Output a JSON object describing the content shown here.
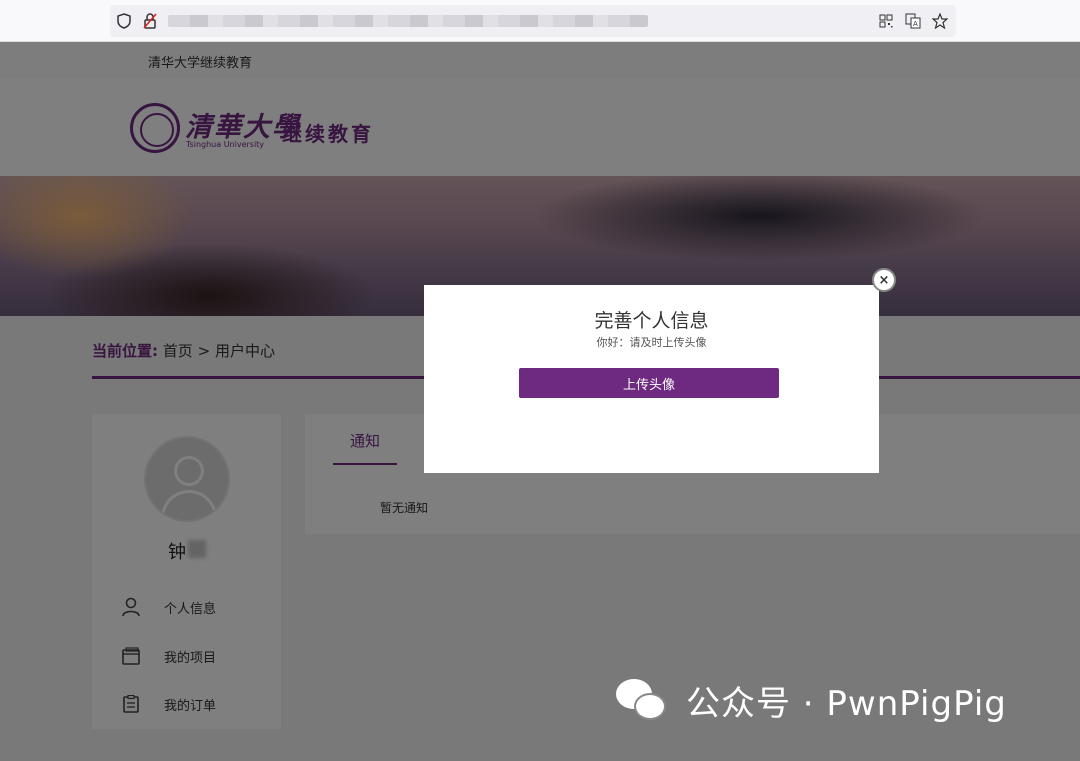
{
  "browser": {
    "icons": [
      "shield-icon",
      "insecure-lock-icon",
      "qr-code-icon",
      "translate-icon",
      "star-icon"
    ]
  },
  "site": {
    "top_text": "清华大学继续教育",
    "logo_cn": "清華大學",
    "logo_en": "Tsinghua University",
    "logo_sub": "继续教育"
  },
  "breadcrumb": {
    "label": "当前位置:",
    "home": "首页",
    "separator": ">",
    "current": "用户中心"
  },
  "user": {
    "name": "钟"
  },
  "sidebar": {
    "items": [
      {
        "label": "个人信息",
        "icon": "person-icon"
      },
      {
        "label": "我的项目",
        "icon": "folder-icon"
      },
      {
        "label": "我的订单",
        "icon": "clipboard-icon"
      }
    ]
  },
  "content": {
    "tab": "通知",
    "empty_text": "暂无通知"
  },
  "modal": {
    "title": "完善个人信息",
    "subtitle": "你好：请及时上传头像",
    "button": "上传头像",
    "close": "×"
  },
  "watermark": {
    "text": "公众号 · PwnPigPig"
  },
  "colors": {
    "accent": "#6e2a80",
    "overlay": "rgba(0,0,0,0.5)"
  }
}
